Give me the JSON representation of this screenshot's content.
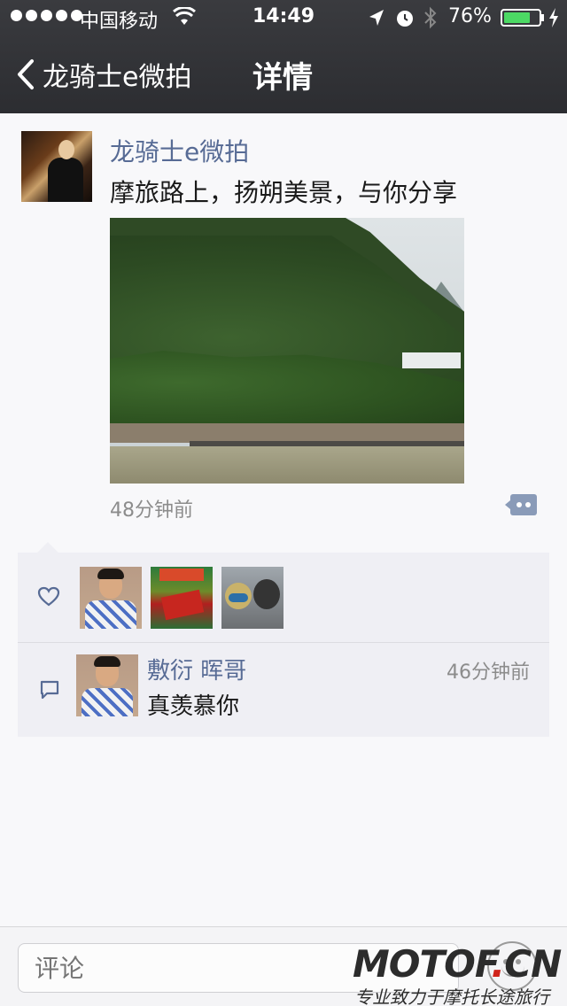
{
  "status_bar": {
    "carrier": "中国移动",
    "time": "14:49",
    "battery": "76%",
    "battery_level": 0.76
  },
  "nav": {
    "back_label": "龙骑士e微拍",
    "title": "详情"
  },
  "post": {
    "author": "龙骑士e微拍",
    "text": "摩旅路上，扬朔美景，与你分享",
    "time": "48分钟前"
  },
  "likes": {
    "avatars": [
      "avatar-1",
      "avatar-2",
      "avatar-3"
    ]
  },
  "comments": [
    {
      "author": "敷衍 晖哥",
      "time": "46分钟前",
      "text": "真羡慕你"
    }
  ],
  "input": {
    "placeholder": "评论"
  },
  "watermark": {
    "logo_main": "MOTOF",
    "logo_accent": ".",
    "logo_tail": "CN",
    "tagline": "专业致力于摩托长途旅行"
  },
  "colors": {
    "link_blue": "#576b95",
    "panel_bg": "#efeff4",
    "nav_bg": "#2c2d31",
    "battery_green": "#4cd964"
  }
}
